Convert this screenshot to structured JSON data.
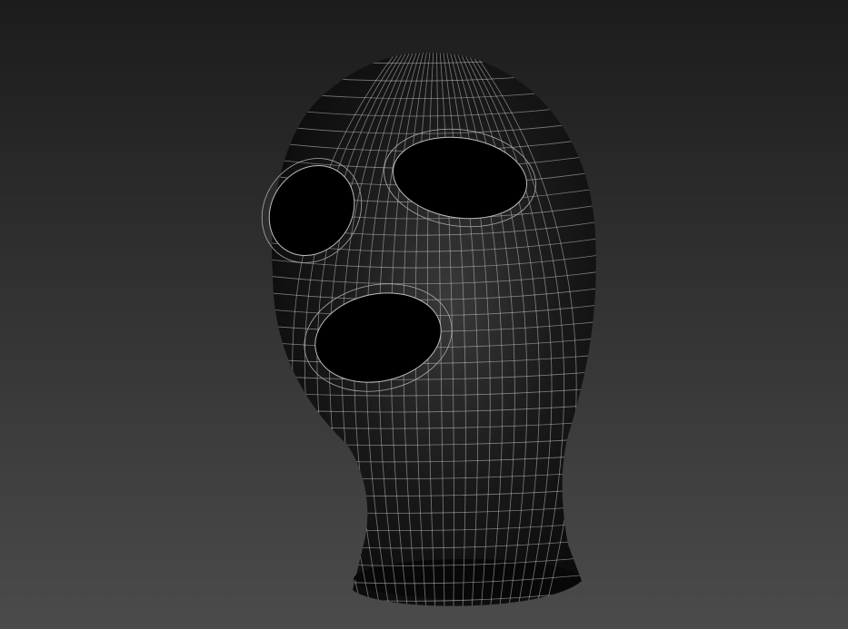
{
  "viewport": {
    "colors": {
      "background_top": "#1c1c1c",
      "background_bottom": "#4b4b4b",
      "mesh_surface": "#0c0c0c",
      "mesh_highlight": "#3a3a3a",
      "wireframe": "#cfcfcf"
    },
    "object": "balaclava-mesh"
  }
}
